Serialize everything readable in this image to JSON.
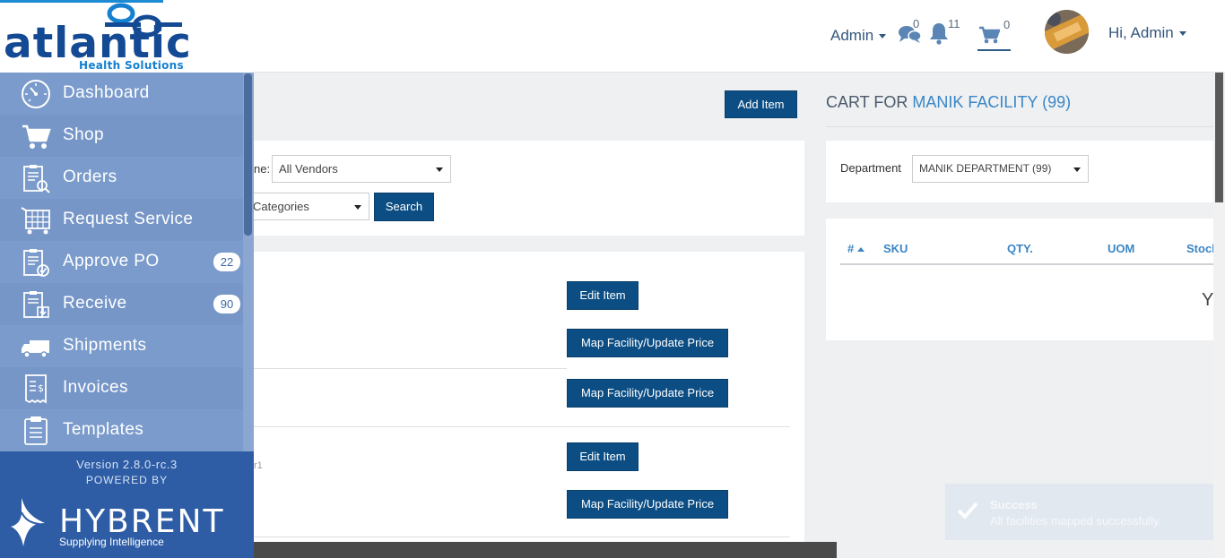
{
  "brand": {
    "logo_text": "atlantic",
    "logo_subtext": "Health Solutions"
  },
  "header": {
    "admin_menu_label": "Admin",
    "messages_count": "0",
    "notifications_count": "11",
    "cart_count": "0",
    "greeting": "Hi, Admin"
  },
  "sidebar": {
    "items": [
      {
        "label": "Dashboard",
        "icon": "dashboard-icon"
      },
      {
        "label": "Shop",
        "icon": "cart-icon"
      },
      {
        "label": "Orders",
        "icon": "orders-icon"
      },
      {
        "label": "Request Service",
        "icon": "request-service-icon"
      },
      {
        "label": "Approve PO",
        "icon": "approve-po-icon",
        "badge": "22"
      },
      {
        "label": "Receive",
        "icon": "receive-icon",
        "badge": "90"
      },
      {
        "label": "Shipments",
        "icon": "truck-icon"
      },
      {
        "label": "Invoices",
        "icon": "invoice-icon"
      },
      {
        "label": "Templates",
        "icon": "templates-icon"
      }
    ],
    "version": "Version 2.8.0-rc.3",
    "powered_by": "POWERED BY",
    "company": "HYBRENT",
    "tagline": "Supplying Intelligence"
  },
  "main": {
    "add_item_label": "Add Item",
    "vendor_label_partial": "ne:",
    "vendor_select": "All Vendors",
    "category_select_partial": "Categories",
    "search_label": "Search",
    "edit_item_label": "Edit Item",
    "map_facility_label": "Map Facility/Update Price",
    "row3_partial_text": "r1"
  },
  "cart": {
    "title_prefix": "CART FOR",
    "facility": "MANIK FACILITY (99)",
    "department_label": "Department",
    "department_select": "MANIK DEPARTMENT (99)",
    "columns": [
      "#",
      "SKU",
      "QTY.",
      "UOM",
      "Stock"
    ],
    "empty_partial": "Y"
  },
  "toast": {
    "title": "Success",
    "message": "All facilities mapped successfully."
  },
  "colors": {
    "primary_button": "#0c4e84",
    "sidebar": "#7a9bcb",
    "sidebar_footer": "#2e5da6",
    "link_blue": "#3a86c6"
  }
}
